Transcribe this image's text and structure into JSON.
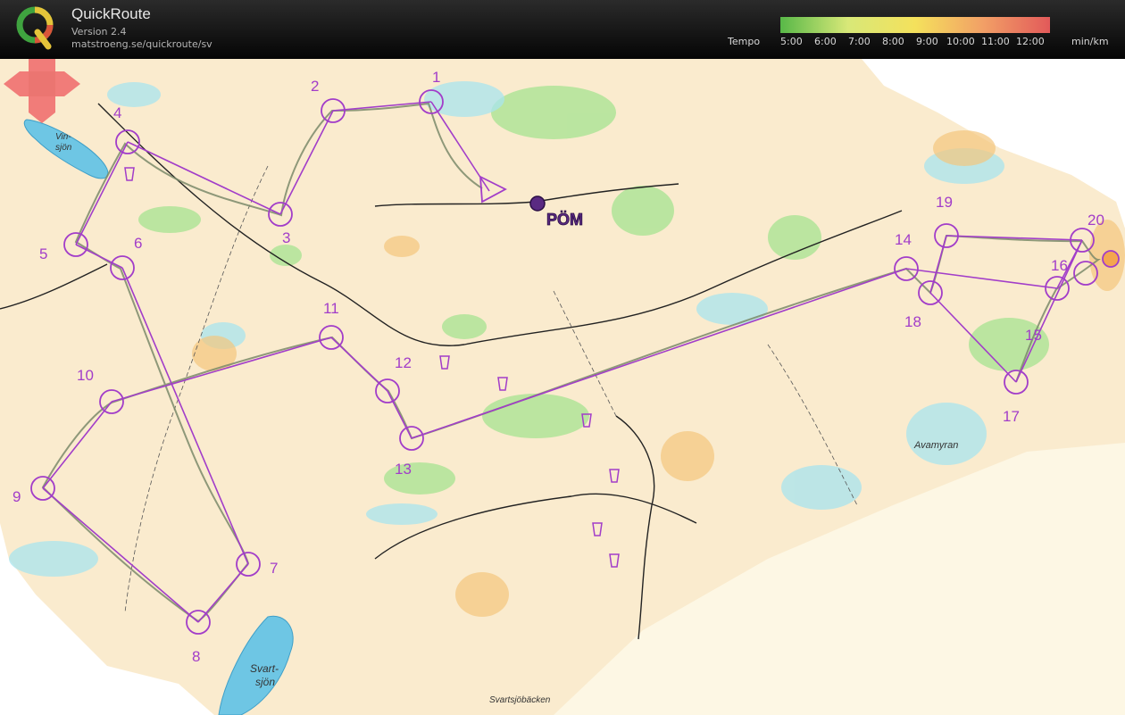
{
  "app": {
    "title": "QuickRoute",
    "version": "Version 2.4",
    "url": "matstroeng.se/quickroute/sv",
    "logo_icon": "quickroute-q-logo"
  },
  "tempo": {
    "label": "Tempo",
    "ticks": [
      "5:00",
      "6:00",
      "7:00",
      "8:00",
      "9:00",
      "10:00",
      "11:00",
      "12:00"
    ],
    "unit": "min/km",
    "colors": [
      "#58b848",
      "#d8e878",
      "#f4e15c",
      "#f2a066",
      "#e25a5a"
    ]
  },
  "map": {
    "course_color": "#a23dc9",
    "route_color": "#7a8a6a",
    "start_label": "PÖM",
    "controls": [
      "1",
      "2",
      "3",
      "4",
      "5",
      "6",
      "7",
      "8",
      "9",
      "10",
      "11",
      "12",
      "13",
      "14",
      "15",
      "16",
      "17",
      "18",
      "19",
      "20"
    ],
    "place_names": [
      "Vin-",
      "sjön",
      "Avamyran",
      "Svart-",
      "sjön",
      "Svartsjöbäcken"
    ]
  }
}
